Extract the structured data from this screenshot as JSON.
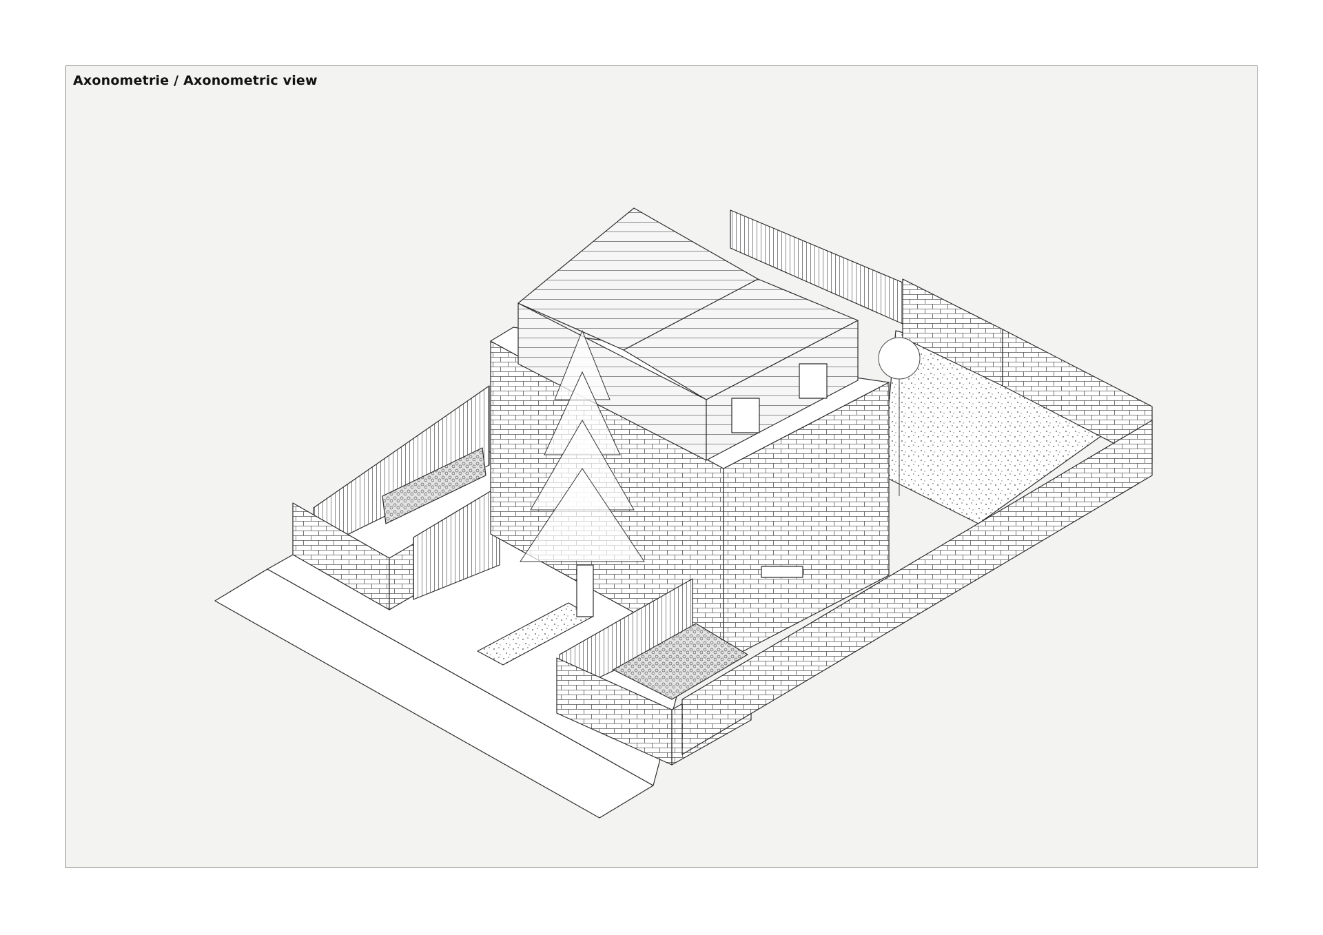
{
  "sheet": {
    "title": "Axonometrie / Axonometric view"
  },
  "colors": {
    "background": "#f3f4f2",
    "paper": "#ffffff",
    "line": "#2b2b2b",
    "frame": "#8a8a8a"
  },
  "icons": {
    "tree": "conifer-tree-icon",
    "shrubs": "planter-shrubs-icon"
  }
}
